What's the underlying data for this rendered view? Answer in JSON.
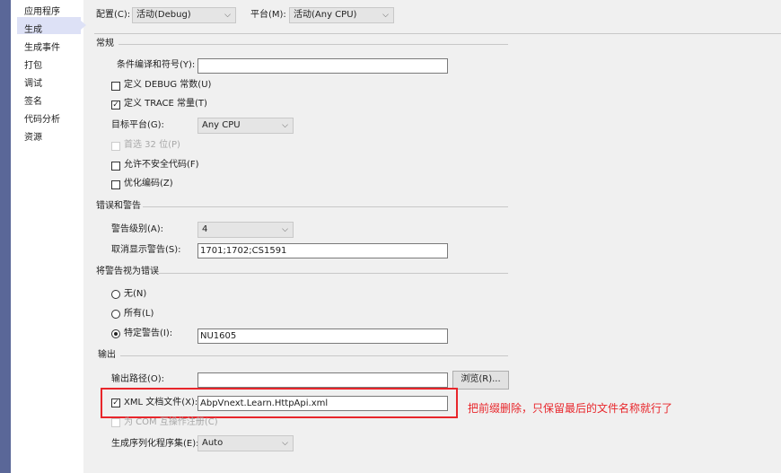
{
  "sidebar": {
    "items": [
      "应用程序",
      "生成",
      "生成事件",
      "打包",
      "调试",
      "签名",
      "代码分析",
      "资源"
    ],
    "selected": "生成"
  },
  "top": {
    "config_label": "配置(C):",
    "config_value": "活动(Debug)",
    "platform_label": "平台(M):",
    "platform_value": "活动(Any CPU)"
  },
  "general": {
    "title": "常规",
    "cond_label": "条件编译和符号(Y):",
    "cond_value": "",
    "debug_label": "定义 DEBUG 常数(U)",
    "debug_checked": false,
    "trace_label": "定义 TRACE 常量(T)",
    "trace_checked": true,
    "target_label": "目标平台(G):",
    "target_value": "Any CPU",
    "prefer32_label": "首选 32 位(P)",
    "unsafe_label": "允许不安全代码(F)",
    "optimize_label": "优化编码(Z)"
  },
  "errors": {
    "title": "错误和警告",
    "level_label": "警告级别(A):",
    "level_value": "4",
    "suppress_label": "取消显示警告(S):",
    "suppress_value": "1701;1702;CS1591"
  },
  "treat": {
    "title": "将警告视为错误",
    "none_label": "无(N)",
    "all_label": "所有(L)",
    "specific_label": "特定警告(I):",
    "specific_value": "NU1605",
    "selected": "specific"
  },
  "output": {
    "title": "输出",
    "path_label": "输出路径(O):",
    "path_value": "",
    "browse_label": "浏览(R)...",
    "xml_label": "XML 文档文件(X):",
    "xml_checked": true,
    "xml_value": "AbpVnext.Learn.HttpApi.xml",
    "com_label": "为 COM 互操作注册(C)",
    "serial_label": "生成序列化程序集(E):",
    "serial_value": "Auto"
  },
  "annotation": {
    "text": "把前缀删除，只保留最后的文件名称就行了",
    "color": "#e8262b"
  }
}
